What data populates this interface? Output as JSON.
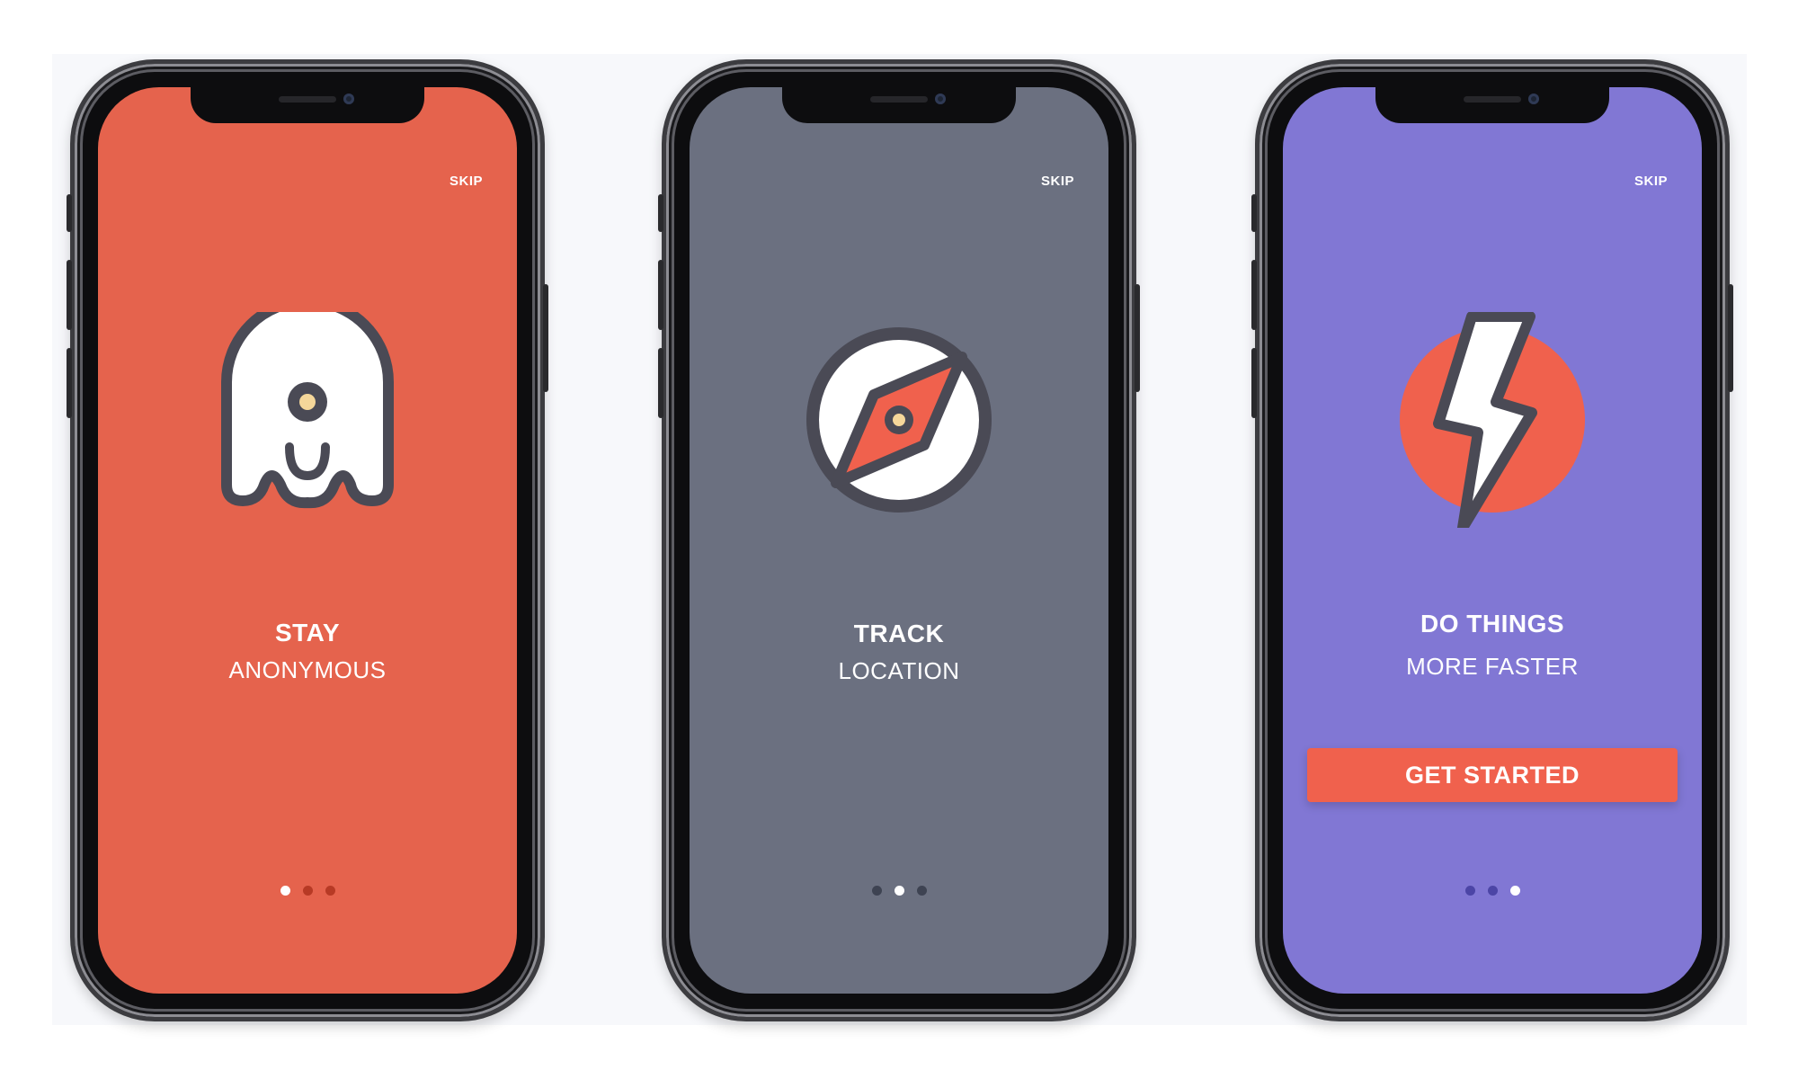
{
  "colors": {
    "screen_1_bg": "#e5634d",
    "screen_2_bg": "#6b7080",
    "screen_3_bg": "#8177d4",
    "accent": "#f0614d",
    "icon_stroke": "#4a4a55",
    "icon_fill": "#ffffff",
    "eye_fill": "#f5d79a",
    "dot_active": "#ffffff",
    "dot_inactive_1": "#b73a25",
    "dot_inactive_2": "#3e4352",
    "dot_inactive_3": "#4c45a6"
  },
  "screens": [
    {
      "skip_label": "SKIP",
      "icon": "ghost-icon",
      "title": "STAY",
      "subtitle": "ANONYMOUS",
      "page_index": 1,
      "page_count": 3
    },
    {
      "skip_label": "SKIP",
      "icon": "compass-icon",
      "title": "TRACK",
      "subtitle": "LOCATION",
      "page_index": 2,
      "page_count": 3
    },
    {
      "skip_label": "SKIP",
      "icon": "lightning-bolt-icon",
      "title": "DO THINGS",
      "subtitle": "MORE FASTER",
      "button_label": "GET STARTED",
      "page_index": 3,
      "page_count": 3
    }
  ]
}
